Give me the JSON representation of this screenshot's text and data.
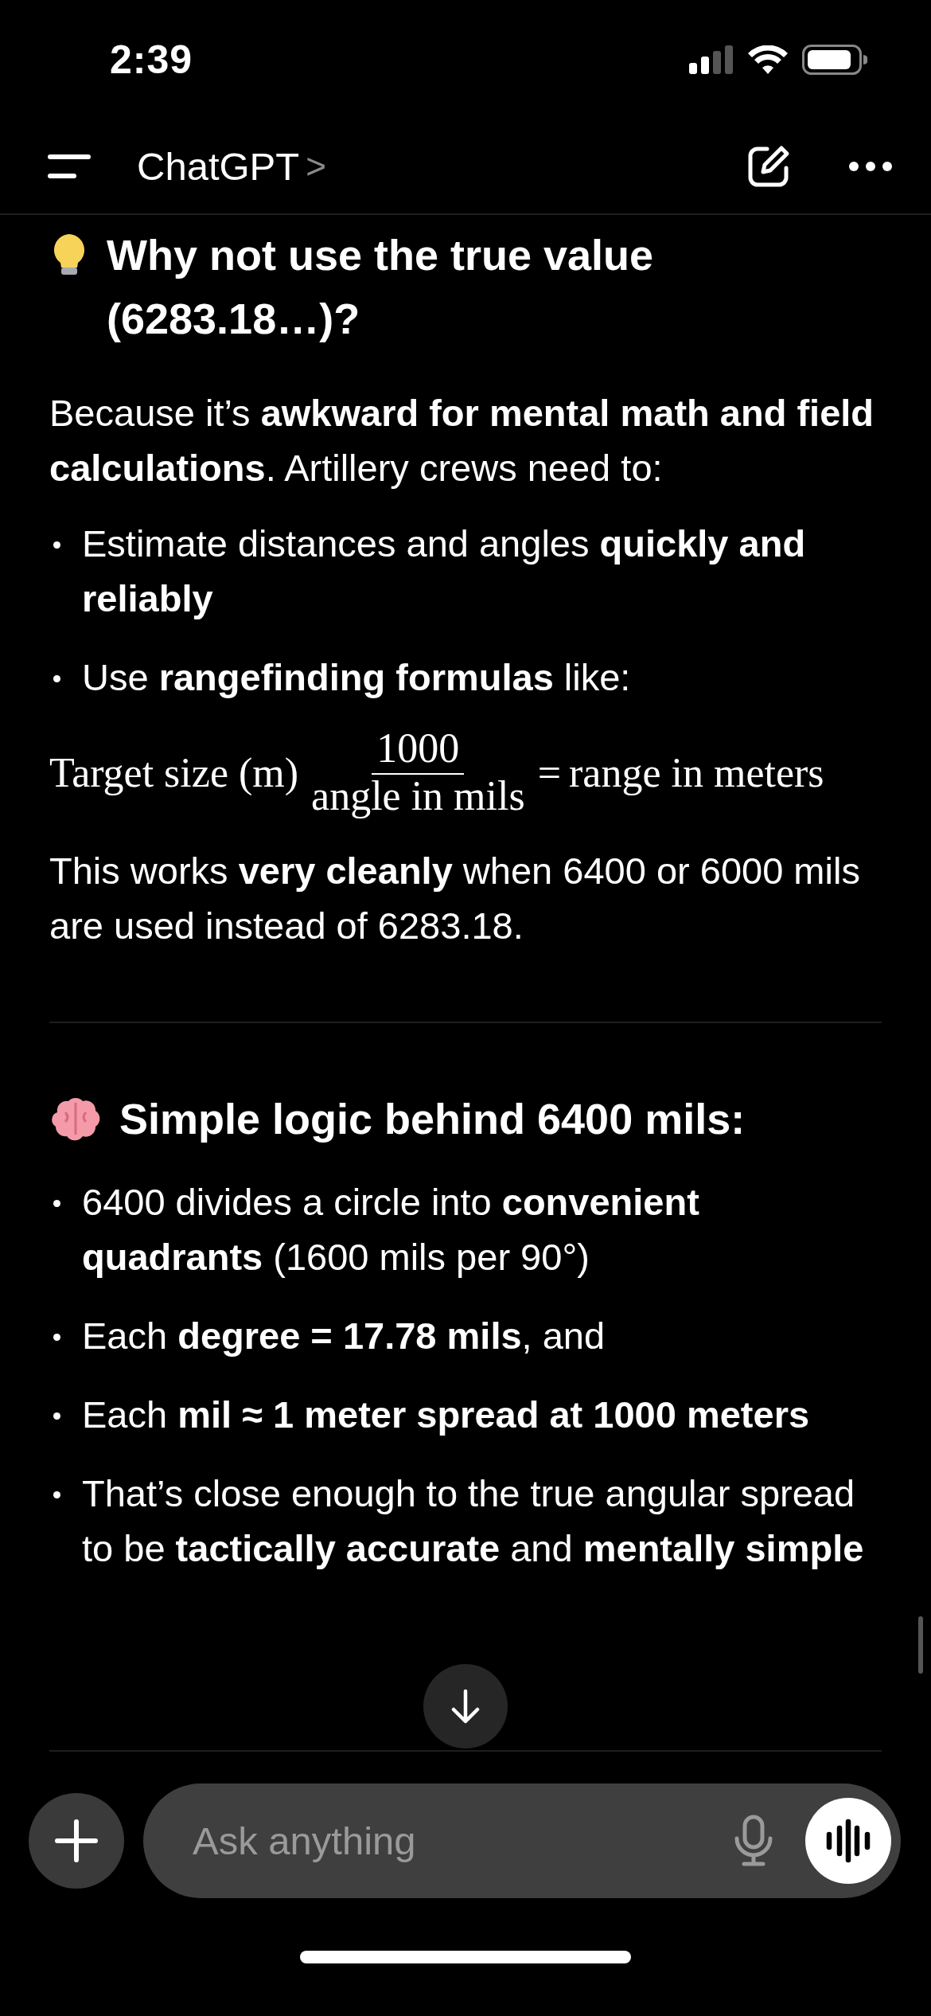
{
  "status_bar": {
    "time": "2:39"
  },
  "header": {
    "title": "ChatGPT",
    "chevron": ">"
  },
  "message": [
    {
      "kind": "heading",
      "text": "Why not use the true value (6283.18…)?"
    },
    {
      "kind": "paragraph",
      "text": "Because it’s **awkward for mental math and field calculations**. Artillery crews need to:"
    },
    {
      "kind": "bullet",
      "text": "Estimate distances and angles **quickly and reliably**"
    },
    {
      "kind": "bullet",
      "text": "Use **rangefinding formulas** like:"
    },
    {
      "kind": "formula",
      "lhs": "Target size (m)",
      "numerator": "1000",
      "denominator": "angle in mils",
      "equals": "=",
      "rhs": "range in meters"
    },
    {
      "kind": "paragraph",
      "text": "This works **very cleanly** when 6400 or 6000 mils are used instead of 6283.18."
    },
    {
      "kind": "divider"
    },
    {
      "kind": "heading",
      "text": "Simple logic behind 6400 mils:"
    },
    {
      "kind": "bullet",
      "text": "6400 divides a circle into **convenient quadrants** (1600 mils per 90°)"
    },
    {
      "kind": "bullet",
      "text": "Each **degree = 17.78 mils**, and"
    },
    {
      "kind": "bullet",
      "text": "Each **mil ≈ 1 meter spread at 1000 meters**"
    },
    {
      "kind": "bullet",
      "text": "That’s close enough to the true angular spread to be **tactically accurate** and **mentally simple**"
    }
  ],
  "composer": {
    "placeholder": "Ask anything"
  }
}
